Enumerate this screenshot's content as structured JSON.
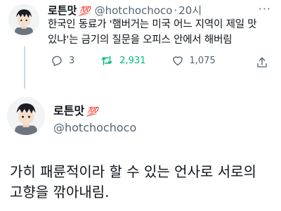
{
  "tweet1": {
    "display_name": "로튼맛",
    "badge": "💯",
    "handle": "@hotchochoco",
    "separator": "·",
    "time": "20시",
    "more": "···",
    "text_line1": "한국인 동료가 '햄버거는 미국 어느 지역이 제일 맛",
    "text_line2": "있냐'는 금기의 질문을 오피스 안에서 해버림",
    "replies": "3",
    "retweets": "2,931",
    "likes": "1,075"
  },
  "tweet2": {
    "display_name": "로튼맛",
    "badge": "💯",
    "handle": "@hotchochoco",
    "text_line1": "가히 패륜적이라 할 수 있는 언사로 서로의",
    "text_line2": "고향을 깎아내림."
  },
  "icons": {
    "avatar": "anime-boy-avatar",
    "reply": "reply-icon",
    "retweet": "retweet-icon",
    "like": "like-icon",
    "share": "share-icon"
  },
  "colors": {
    "text": "#0f1419",
    "secondary": "#536471",
    "retweet_active": "#00ba7c",
    "badge": "#e0245e",
    "thread_line": "#cfd9de"
  }
}
